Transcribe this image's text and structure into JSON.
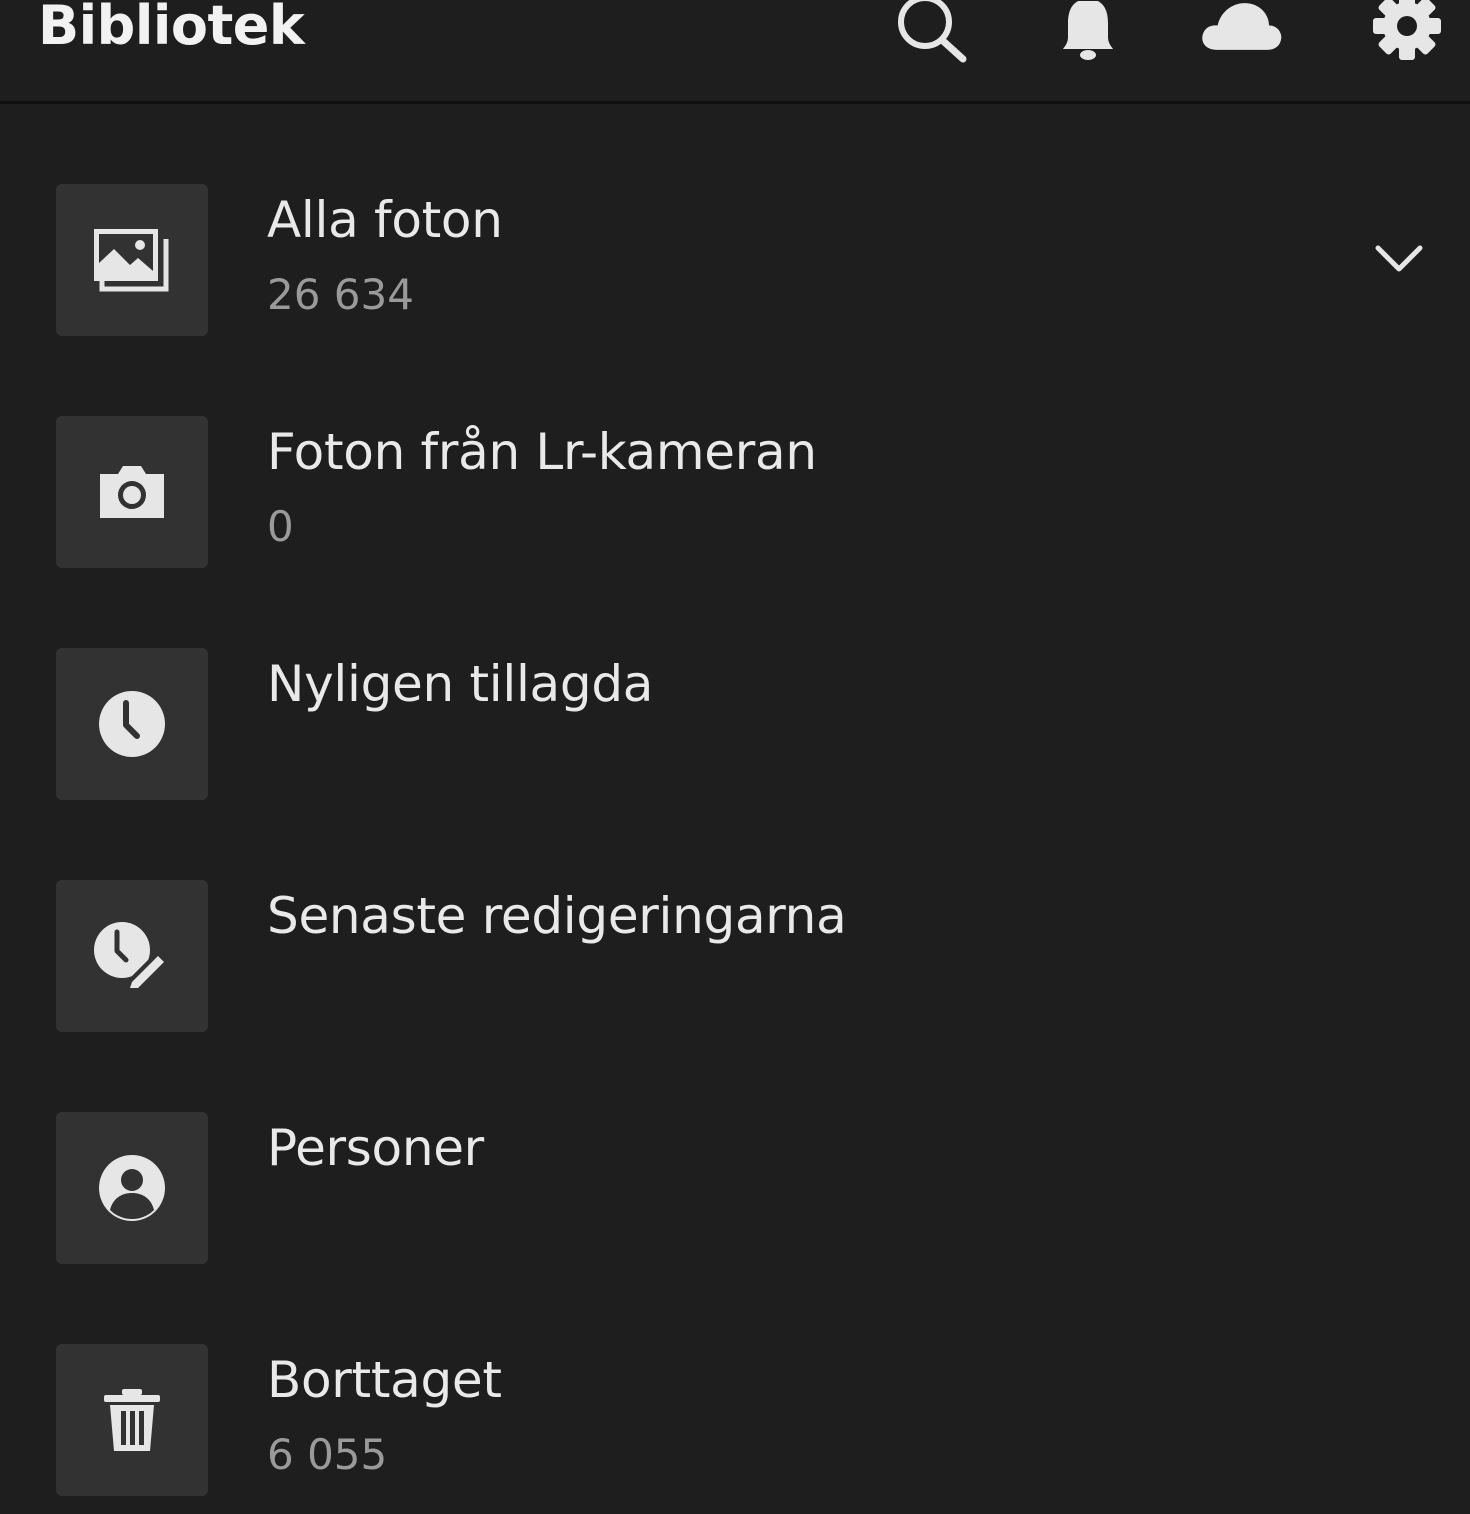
{
  "header": {
    "title": "Bibliotek",
    "icons": [
      "search-icon",
      "bell-icon",
      "cloud-icon",
      "gear-icon"
    ]
  },
  "library": {
    "items": [
      {
        "label": "Alla foton",
        "count": "26 634",
        "icon": "photos-icon",
        "expandable": true
      },
      {
        "label": "Foton från Lr-kameran",
        "count": "0",
        "icon": "camera-icon"
      },
      {
        "label": "Nyligen tillagda",
        "count": "",
        "icon": "clock-icon"
      },
      {
        "label": "Senaste redigeringarna",
        "count": "",
        "icon": "clock-edit-icon"
      },
      {
        "label": "Personer",
        "count": "",
        "icon": "person-icon"
      },
      {
        "label": "Borttaget",
        "count": "6 055",
        "icon": "trash-icon"
      }
    ]
  },
  "colors": {
    "background": "#1e1e1e",
    "tile": "#323232",
    "icon": "#e6e6e6",
    "count_text": "#9a9a9a"
  }
}
